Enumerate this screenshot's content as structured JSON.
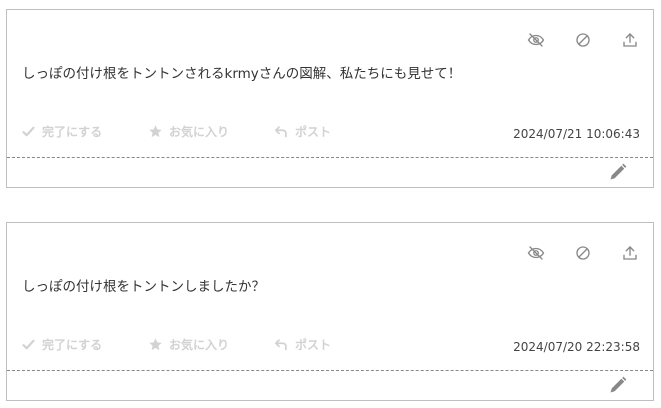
{
  "posts": [
    {
      "message": "しっぽの付け根をトントンされるkrmyさんの図解、私たちにも見せて！",
      "timestamp": "2024/07/21 10:06:43",
      "actions": {
        "complete": "完了にする",
        "favorite": "お気に入り",
        "post": "ポスト"
      }
    },
    {
      "message": "しっぽの付け根をトントンしましたか？",
      "timestamp": "2024/07/20 22:23:58",
      "actions": {
        "complete": "完了にする",
        "favorite": "お気に入り",
        "post": "ポスト"
      }
    }
  ],
  "icons": {
    "top": [
      "eye-slash-icon",
      "block-icon",
      "upload-icon"
    ],
    "actions": [
      "check-icon",
      "star-icon",
      "reply-arrow-icon"
    ],
    "bottom": [
      "pencil-icon"
    ]
  },
  "colors": {
    "border": "#bfbfbf",
    "icon": "#888888",
    "action_disabled": "#d2d2d2",
    "text": "#333333"
  }
}
